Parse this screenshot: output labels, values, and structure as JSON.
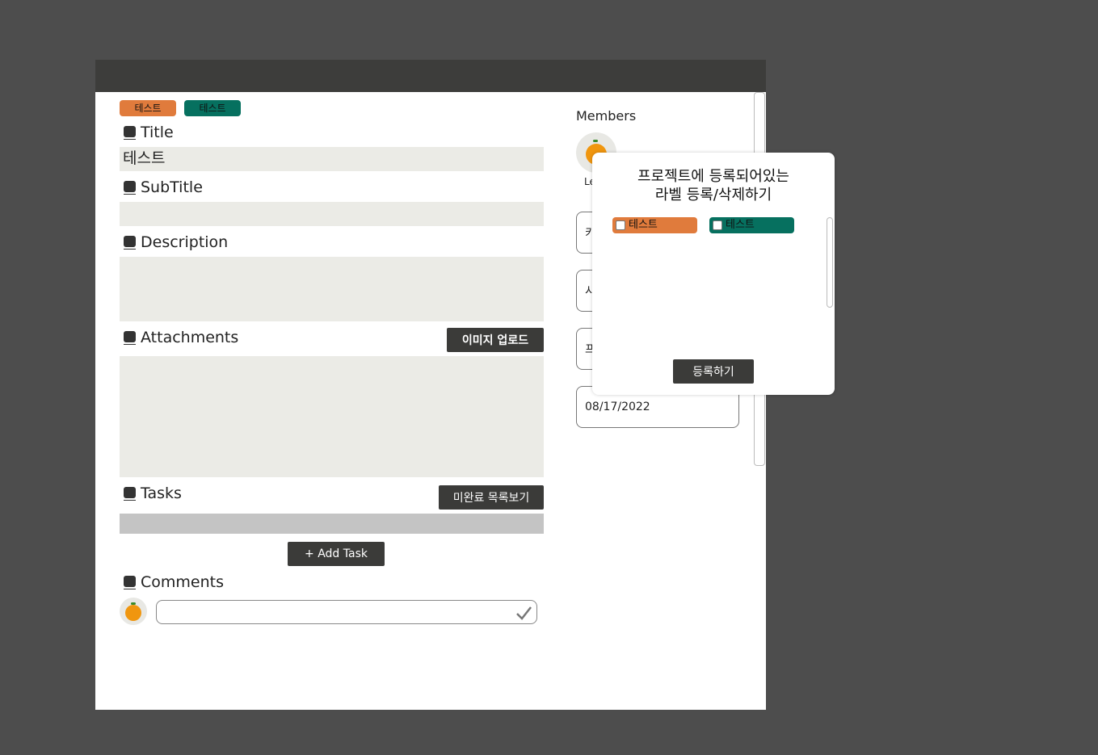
{
  "labels": [
    {
      "text": "테스트",
      "color": "#e07b3c"
    },
    {
      "text": "테스트",
      "color": "#06705f"
    }
  ],
  "sections": {
    "title": "Title",
    "subtitle": "SubTitle",
    "description": "Description",
    "attachments": "Attachments",
    "tasks": "Tasks",
    "comments": "Comments"
  },
  "fields": {
    "title_value": "테스트",
    "subtitle_value": "",
    "description_value": ""
  },
  "buttons": {
    "upload_image": "이미지 업로드",
    "view_incomplete": "미완료 목록보기",
    "add_task": "+ Add Task",
    "register": "등록하기"
  },
  "sidebar": {
    "members_title": "Members",
    "member_name_partial": "Le",
    "box1_partial": "키",
    "box2_partial": "시",
    "box3_partial": "프",
    "date_value": "08/17/2022"
  },
  "comment": {
    "placeholder": ""
  },
  "popup": {
    "title_line1": "프로젝트에 등록되어있는",
    "title_line2": "라벨 등록/삭제하기",
    "labels": [
      {
        "text": "테스트",
        "color": "#e07b3c",
        "checked": false
      },
      {
        "text": "테스트",
        "color": "#06705f",
        "checked": false
      }
    ]
  },
  "icons": [
    "section-icon",
    "check-icon",
    "orange-avatar"
  ]
}
